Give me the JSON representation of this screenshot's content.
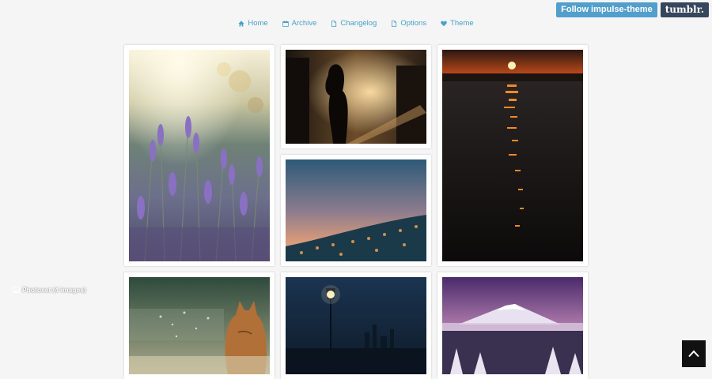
{
  "header": {
    "follow_label": "Follow impulse-theme",
    "logo_text": "tumblr."
  },
  "nav": [
    {
      "label": "Home",
      "icon": "home-icon"
    },
    {
      "label": "Archive",
      "icon": "calendar-icon"
    },
    {
      "label": "Changelog",
      "icon": "document-icon"
    },
    {
      "label": "Options",
      "icon": "document-icon"
    },
    {
      "label": "Theme",
      "icon": "heart-icon"
    }
  ],
  "posts": {
    "photoset_label": "Photoset (4 images)"
  },
  "colors": {
    "accent": "#4aa0c8",
    "follow_button": "#529ecc",
    "tumblr_logo_bg": "#36465d",
    "background": "#f5f5f5"
  },
  "scroll_top": {
    "icon": "chevron-up-icon"
  }
}
